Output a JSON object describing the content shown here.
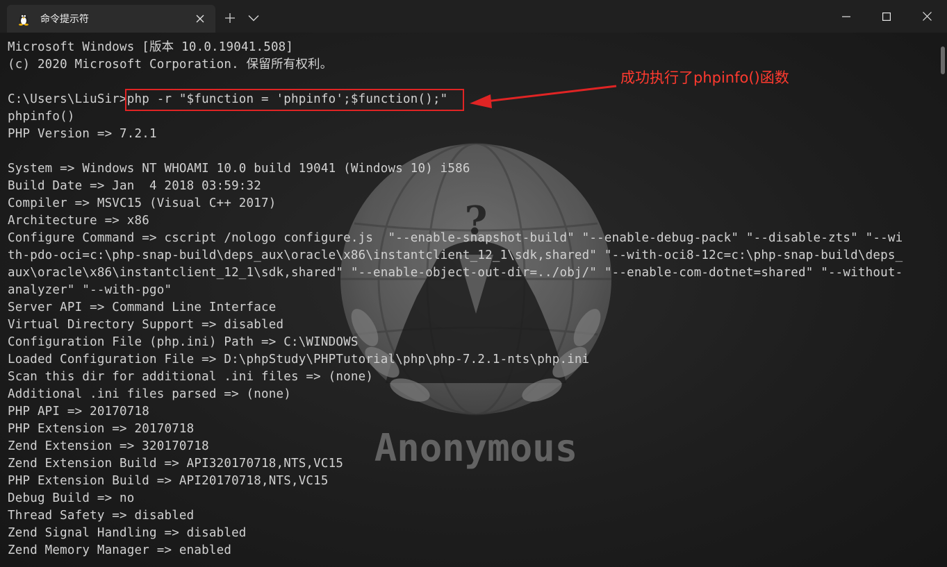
{
  "window": {
    "tab_title": "命令提示符",
    "tab_icon": "linux-penguin-icon",
    "new_tab_icon": "plus-icon",
    "dropdown_icon": "chevron-down-icon",
    "controls": [
      "minimize-icon",
      "maximize-icon",
      "close-icon"
    ]
  },
  "terminal": {
    "lines": [
      "Microsoft Windows [版本 10.0.19041.508]",
      "(c) 2020 Microsoft Corporation. 保留所有权利。",
      "",
      "C:\\Users\\LiuSir>php -r \"$function = 'phpinfo';$function();\"",
      "phpinfo()",
      "PHP Version => 7.2.1",
      "",
      "System => Windows NT WHOAMI 10.0 build 19041 (Windows 10) i586",
      "Build Date => Jan  4 2018 03:59:32",
      "Compiler => MSVC15 (Visual C++ 2017)",
      "Architecture => x86",
      "Configure Command => cscript /nologo configure.js  \"--enable-snapshot-build\" \"--enable-debug-pack\" \"--disable-zts\" \"--wi",
      "th-pdo-oci=c:\\php-snap-build\\deps_aux\\oracle\\x86\\instantclient_12_1\\sdk,shared\" \"--with-oci8-12c=c:\\php-snap-build\\deps_",
      "aux\\oracle\\x86\\instantclient_12_1\\sdk,shared\" \"--enable-object-out-dir=../obj/\" \"--enable-com-dotnet=shared\" \"--without-",
      "analyzer\" \"--with-pgo\"",
      "Server API => Command Line Interface",
      "Virtual Directory Support => disabled",
      "Configuration File (php.ini) Path => C:\\WINDOWS",
      "Loaded Configuration File => D:\\phpStudy\\PHPTutorial\\php\\php-7.2.1-nts\\php.ini",
      "Scan this dir for additional .ini files => (none)",
      "Additional .ini files parsed => (none)",
      "PHP API => 20170718",
      "PHP Extension => 20170718",
      "Zend Extension => 320170718",
      "Zend Extension Build => API320170718,NTS,VC15",
      "PHP Extension Build => API20170718,NTS,VC15",
      "Debug Build => no",
      "Thread Safety => disabled",
      "Zend Signal Handling => disabled",
      "Zend Memory Manager => enabled"
    ],
    "background_text": "Anonymous",
    "background_symbol": "?"
  },
  "annotation": {
    "text": "成功执行了phpinfo()函数",
    "color": "#ff3a2f"
  }
}
